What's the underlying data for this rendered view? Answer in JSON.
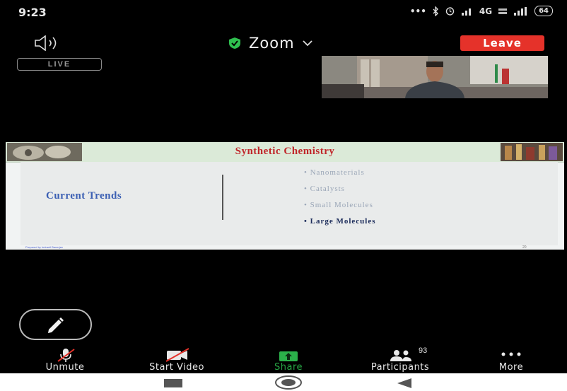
{
  "status": {
    "time": "9:23",
    "signal_text": "4G",
    "battery": "64"
  },
  "meeting": {
    "title": "Zoom",
    "leave_label": "Leave",
    "live_label": "LIVE"
  },
  "slide": {
    "title": "Synthetic Chemistry",
    "left_heading": "Current Trends",
    "bullets": [
      "Nanomaterials",
      "Catalysts",
      "Small Molecules",
      "Large Molecules"
    ],
    "active_bullet": 3,
    "footer": "Prepared by Indranil Banerjee",
    "page_number": "20"
  },
  "participants_count": "93",
  "toolbar": {
    "unmute": "Unmute",
    "start_video": "Start Video",
    "share": "Share",
    "participants": "Participants",
    "more": "More"
  },
  "colors": {
    "leave": "#e5322a",
    "share": "#2bb04a",
    "slide_title": "#c0262a",
    "slide_heading": "#3b5fb3"
  }
}
